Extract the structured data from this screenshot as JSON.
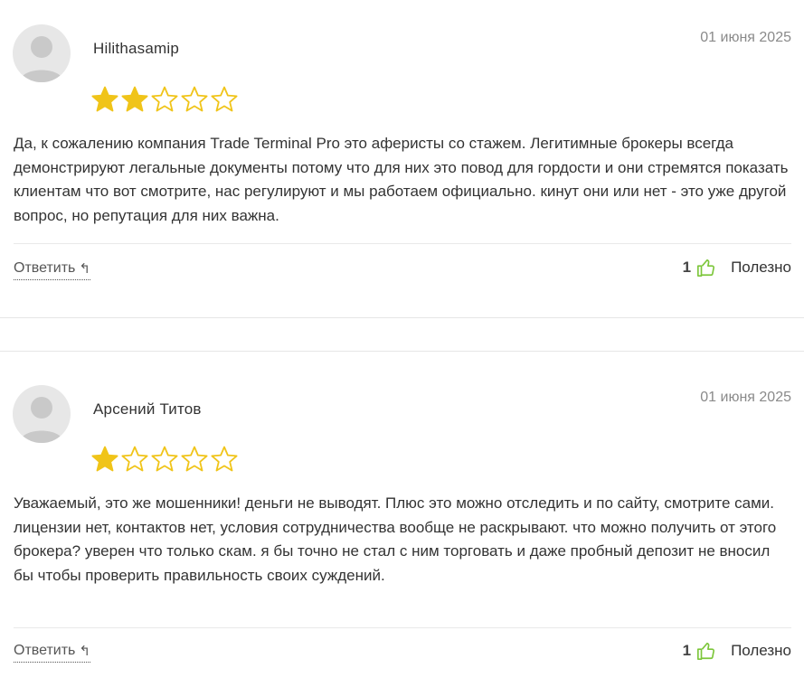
{
  "reviews": [
    {
      "author": "Hilithasamip",
      "date": "01 июня 2025",
      "rating": 2,
      "max_rating": 5,
      "text": "Да, к сожалению компания Trade Terminal Pro это аферисты со стажем. Легитимные брокеры всегда демонстрируют легальные документы потому что для них это повод для гордости и они стремятся показать клиентам что вот смотрите, нас регулируют и мы работаем официально. кинут они или нет - это уже другой вопрос, но репутация для них важна.",
      "reply_label": "Ответить",
      "reply_icon": "↰",
      "useful_count": "1",
      "useful_label": "Полезно"
    },
    {
      "author": "Арсений Титов",
      "date": "01 июня 2025",
      "rating": 1,
      "max_rating": 5,
      "text": "Уважаемый, это же мошенники! деньги не выводят. Плюс это можно отследить и по сайту, смотрите сами. лицензии нет, контактов нет, условия сотрудничества вообще не раскрывают. что можно получить от этого брокера? уверен что только скам. я бы точно не стал с ним торговать и даже пробный депозит не вносил бы чтобы проверить правильность своих суждений.",
      "reply_label": "Ответить",
      "reply_icon": "↰",
      "useful_count": "1",
      "useful_label": "Полезно"
    }
  ],
  "colors": {
    "star_filled": "#f0c419",
    "star_empty_stroke": "#f0c419",
    "thumb": "#7cc63a",
    "avatar_bg": "#e7e7e7",
    "avatar_fg": "#c9c9c9",
    "date": "#8a8a8a"
  },
  "icons": {
    "avatar": "user-avatar-icon",
    "star": "star-icon",
    "thumb": "thumbs-up-icon",
    "reply": "reply-arrow-icon"
  }
}
